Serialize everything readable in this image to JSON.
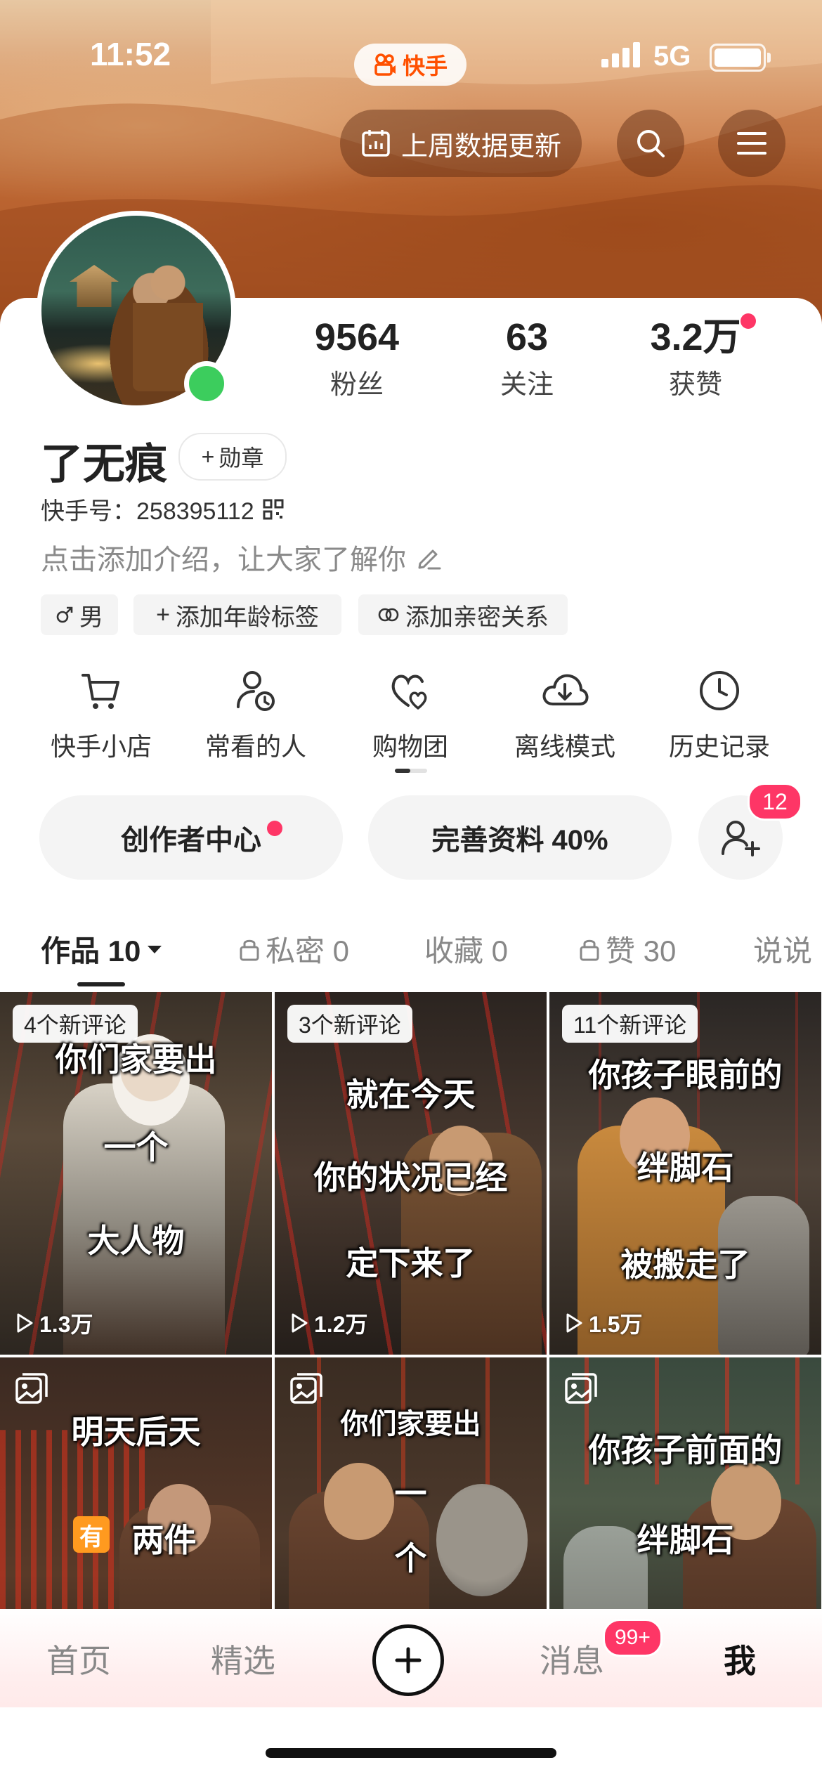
{
  "status_bar": {
    "time": "11:52",
    "app_name": "快手",
    "network": "5G"
  },
  "header": {
    "data_update_label": "上周数据更新",
    "search_icon": "search-icon",
    "menu_icon": "menu-icon"
  },
  "profile": {
    "stats": [
      {
        "value": "9564",
        "label": "粉丝"
      },
      {
        "value": "63",
        "label": "关注"
      },
      {
        "value": "3.2万",
        "label": "获赞"
      }
    ],
    "name": "了无痕",
    "medal_label": "勋章",
    "kuaishou_id_label": "快手号：",
    "kuaishou_id": "258395112",
    "intro_placeholder": "点击添加介绍，让大家了解你",
    "tags": [
      {
        "icon": "male-icon",
        "label": "男"
      },
      {
        "icon": "plus-icon",
        "label": "添加年龄标签"
      },
      {
        "icon": "link-icon",
        "label": "添加亲密关系"
      }
    ]
  },
  "shortcuts": [
    {
      "icon": "cart-icon",
      "label": "快手小店"
    },
    {
      "icon": "user-clock-icon",
      "label": "常看的人"
    },
    {
      "icon": "heart-group-icon",
      "label": "购物团"
    },
    {
      "icon": "cloud-download-icon",
      "label": "离线模式"
    },
    {
      "icon": "clock-icon",
      "label": "历史记录"
    }
  ],
  "actions": {
    "creator_center": "创作者中心",
    "complete_profile": "完善资料 40%",
    "add_friend_badge": "12"
  },
  "content_tabs": [
    {
      "label": "作品 10"
    },
    {
      "label": "私密 0"
    },
    {
      "label": "收藏 0"
    },
    {
      "label": "赞 30"
    },
    {
      "label": "说说"
    }
  ],
  "videos": [
    {
      "comments": "4个新评论",
      "captions": [
        "你们家要出",
        "一个",
        "大人物"
      ],
      "views": "1.3万"
    },
    {
      "comments": "3个新评论",
      "captions": [
        "就在今天",
        "你的状况已经",
        "定下来了"
      ],
      "views": "1.2万"
    },
    {
      "comments": "11个新评论",
      "captions": [
        "你孩子眼前的",
        "绊脚石",
        "被搬走了"
      ],
      "views": "1.5万"
    },
    {
      "captions": [
        "明天后天",
        "两件"
      ],
      "badge": "有"
    },
    {
      "captions": [
        "你们家要出",
        "一",
        "个"
      ]
    },
    {
      "captions": [
        "你孩子前面的",
        "绊脚石"
      ]
    }
  ],
  "bottom_nav": {
    "home": "首页",
    "featured": "精选",
    "messages": "消息",
    "messages_badge": "99+",
    "me": "我"
  },
  "colors": {
    "accent_red": "#fe3666",
    "online_green": "#3ccd5d",
    "brand_orange": "#ff5000"
  }
}
